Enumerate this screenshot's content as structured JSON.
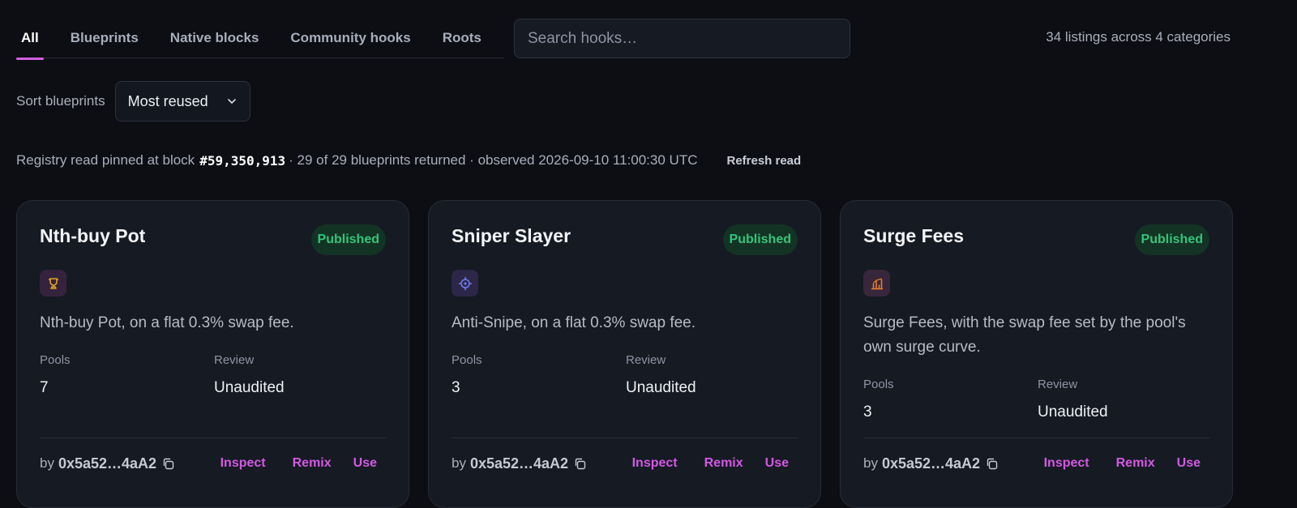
{
  "tabs": [
    {
      "label": "All",
      "active": true
    },
    {
      "label": "Blueprints",
      "active": false
    },
    {
      "label": "Native blocks",
      "active": false
    },
    {
      "label": "Community hooks",
      "active": false
    },
    {
      "label": "Roots",
      "active": false
    }
  ],
  "search": {
    "placeholder": "Search hooks…",
    "value": ""
  },
  "listing_summary": "34 listings across 4 categories",
  "sort": {
    "label": "Sort blueprints",
    "selected": "Most reused"
  },
  "registry": {
    "prefix": "Registry read pinned at block",
    "block": "#59,350,913",
    "suffix": "· 29 of 29 blueprints returned · observed 2026-09-10 11:00:30 UTC",
    "refresh_label": "Refresh read"
  },
  "colors": {
    "accent": "#d25ee0",
    "published_bg": "#133325",
    "published_text": "#35c47a"
  },
  "cards": [
    {
      "title": "Nth-buy Pot",
      "status": "Published",
      "icon": "trophy-cup-icon",
      "icon_color": "#e3a51f",
      "icon_bg": "#35233d",
      "description": "Nth-buy Pot, on a flat 0.3% swap fee.",
      "pools_label": "Pools",
      "pools": "7",
      "review_label": "Review",
      "review": "Unaudited",
      "by_label": "by",
      "author": "0x5a52…4aA2",
      "actions": [
        "Inspect",
        "Remix",
        "Use"
      ]
    },
    {
      "title": "Sniper Slayer",
      "status": "Published",
      "icon": "crosshair-icon",
      "icon_color": "#6c7cf0",
      "icon_bg": "#2c2648",
      "description": "Anti-Snipe, on a flat 0.3% swap fee.",
      "pools_label": "Pools",
      "pools": "3",
      "review_label": "Review",
      "review": "Unaudited",
      "by_label": "by",
      "author": "0x5a52…4aA2",
      "actions": [
        "Inspect",
        "Remix",
        "Use"
      ]
    },
    {
      "title": "Surge Fees",
      "status": "Published",
      "icon": "bar-chart-icon",
      "icon_color": "#e47f2f",
      "icon_bg": "#38263a",
      "description": "Surge Fees, with the swap fee set by the pool's own surge curve.",
      "pools_label": "Pools",
      "pools": "3",
      "review_label": "Review",
      "review": "Unaudited",
      "by_label": "by",
      "author": "0x5a52…4aA2",
      "actions": [
        "Inspect",
        "Remix",
        "Use"
      ]
    }
  ]
}
